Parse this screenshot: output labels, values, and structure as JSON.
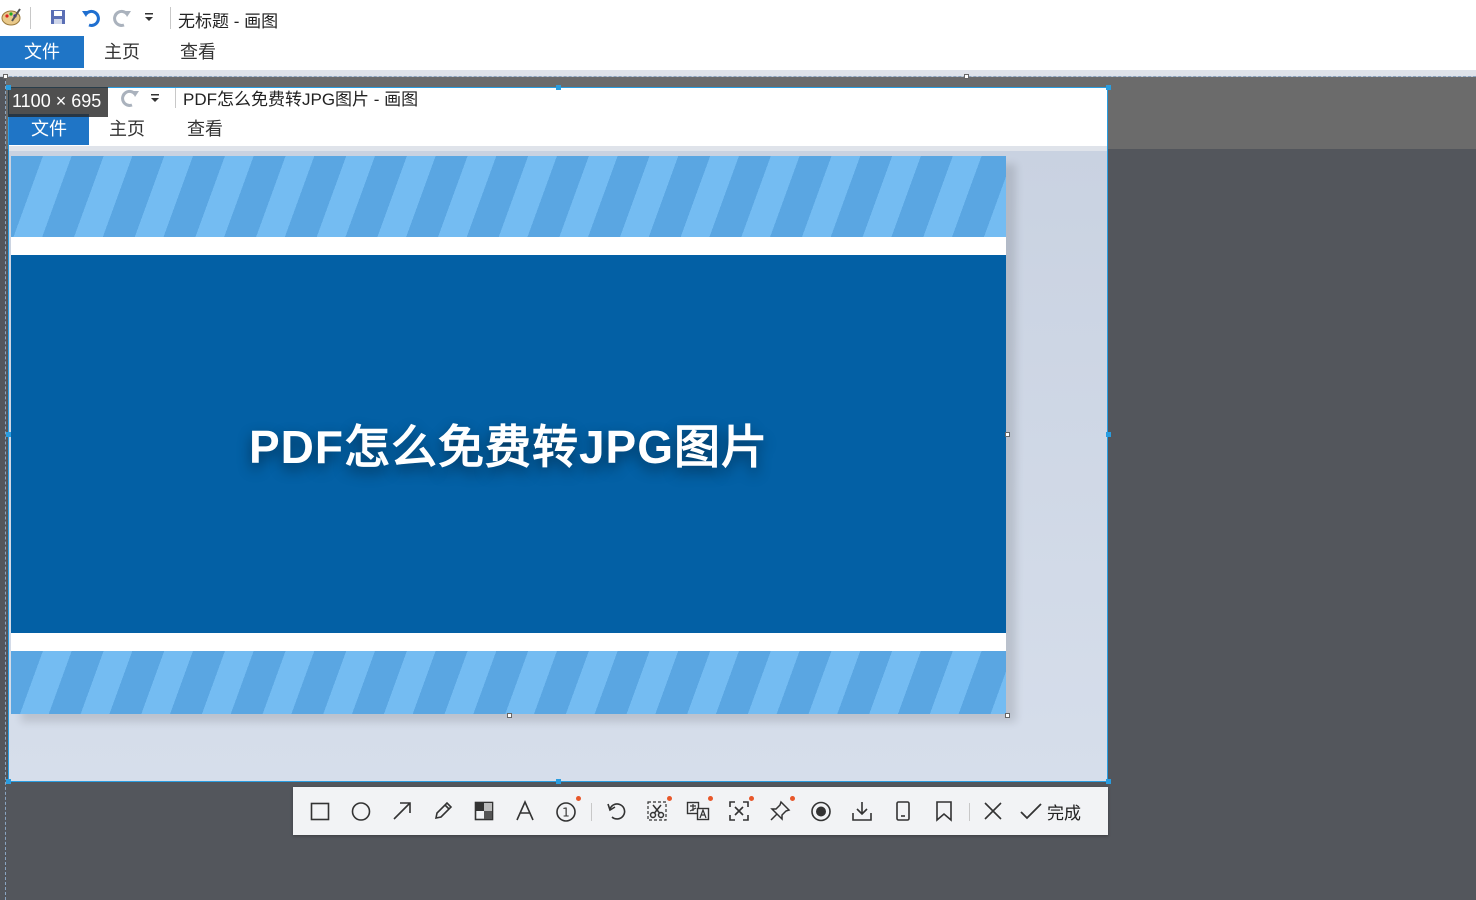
{
  "outer_window": {
    "title": "无标题 - 画图",
    "tabs": [
      {
        "label": "文件"
      },
      {
        "label": "主页"
      },
      {
        "label": "查看"
      }
    ]
  },
  "inner_window": {
    "title": "PDF怎么免费转JPG图片 - 画图",
    "tabs": [
      {
        "label": "文件"
      },
      {
        "label": "主页"
      },
      {
        "label": "查看"
      }
    ]
  },
  "selection": {
    "size_label": "1100 × 695"
  },
  "banner": {
    "headline": "PDF怎么免费转JPG图片"
  },
  "toolbar": {
    "tools": [
      {
        "icon": "rectangle-icon"
      },
      {
        "icon": "ellipse-icon"
      },
      {
        "icon": "arrow-icon"
      },
      {
        "icon": "pencil-icon"
      },
      {
        "icon": "mosaic-icon"
      },
      {
        "icon": "text-icon"
      },
      {
        "icon": "number-marker-icon",
        "marker": "1"
      },
      {
        "icon": "undo-icon"
      },
      {
        "icon": "scissors-icon"
      },
      {
        "icon": "translate-icon"
      },
      {
        "icon": "ocr-icon"
      },
      {
        "icon": "pin-icon"
      },
      {
        "icon": "record-icon"
      },
      {
        "icon": "download-icon"
      },
      {
        "icon": "phone-icon"
      },
      {
        "icon": "bookmark-icon"
      },
      {
        "icon": "close-icon"
      }
    ],
    "done_label": "完成"
  },
  "colors": {
    "accent": "#1f75c6",
    "selection_border": "#2a9de0",
    "banner_blue": "#0360a5",
    "stripe_light": "#74bcf2",
    "stripe_dark": "#5aa6e2",
    "notify_dot": "#e8572a"
  }
}
